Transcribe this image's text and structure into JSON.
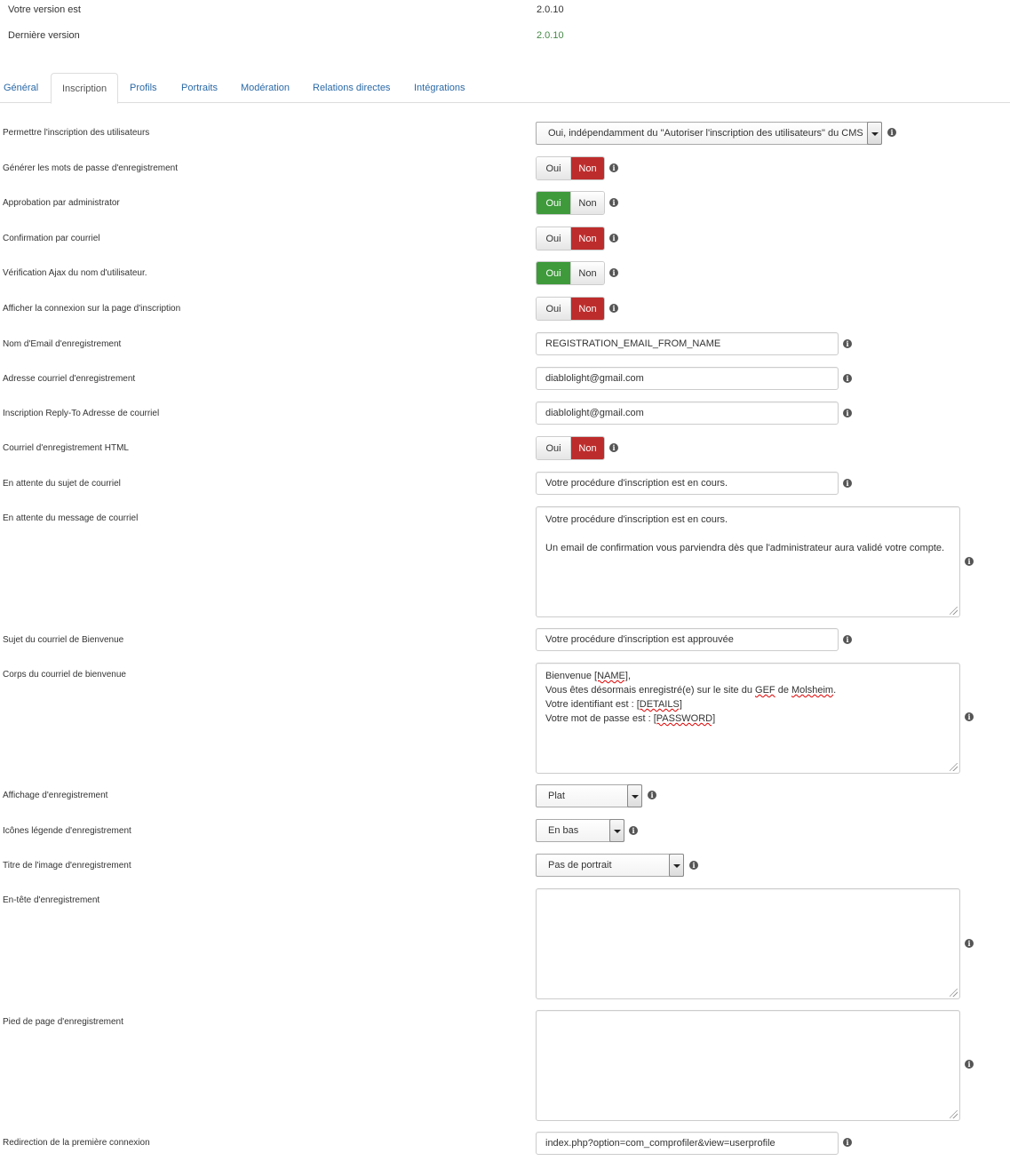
{
  "version": {
    "current_label": "Votre version est",
    "current_value": "2.0.10",
    "latest_label": "Dernière version",
    "latest_value": "2.0.10"
  },
  "tabs": [
    "Général",
    "Inscription",
    "Profils",
    "Portraits",
    "Modération",
    "Relations directes",
    "Intégrations"
  ],
  "active_tab": "Inscription",
  "colors": {
    "link": "#2a69a6",
    "yes_active": "#3e9a3b",
    "no_active": "#bd2c2c",
    "latest_version": "#468847"
  },
  "toggle_labels": {
    "yes": "Oui",
    "no": "Non"
  },
  "fields": {
    "allow_registration": {
      "label": "Permettre l'inscription des utilisateurs",
      "value": "Oui, indépendamment du \"Autoriser l'inscription des utilisateurs\" du CMS"
    },
    "generate_passwords": {
      "label": "Générer les mots de passe d'enregistrement",
      "value": "Non"
    },
    "admin_approval": {
      "label": "Approbation par administrator",
      "value": "Oui"
    },
    "email_confirmation": {
      "label": "Confirmation par courriel",
      "value": "Non"
    },
    "ajax_username_check": {
      "label": "Vérification Ajax du nom d'utilisateur.",
      "value": "Oui"
    },
    "show_login_on_registration": {
      "label": "Afficher la connexion sur la page d'inscription",
      "value": "Non"
    },
    "email_from_name": {
      "label": "Nom d'Email d'enregistrement",
      "value": "REGISTRATION_EMAIL_FROM_NAME"
    },
    "email_from_address": {
      "label": "Adresse courriel d'enregistrement",
      "value": "diablolight@gmail.com"
    },
    "reply_to_address": {
      "label": "Inscription Reply-To Adresse de courriel",
      "value": "diablolight@gmail.com"
    },
    "html_email": {
      "label": "Courriel d'enregistrement HTML",
      "value": "Non"
    },
    "pending_subject": {
      "label": "En attente du sujet de courriel",
      "value": "Votre procédure d'inscription est en cours."
    },
    "pending_message": {
      "label": "En attente du message de courriel",
      "line1": "Votre procédure d'inscription est en cours.",
      "line2": "Un email de confirmation vous parviendra dès que l'administrateur aura validé votre compte."
    },
    "welcome_subject": {
      "label": "Sujet du courriel de Bienvenue",
      "value": "Votre procédure d'inscription est approuvée"
    },
    "welcome_body": {
      "label": "Corps du courriel de bienvenue",
      "l1a": "Bienvenue ",
      "l1b": "[NAME]",
      "l1c": ",",
      "l2a": "Vous êtes désormais enregistré(e) sur le site du ",
      "l2b": "GEF",
      "l2c": " de ",
      "l2d": "Molsheim",
      "l2e": ".",
      "l3a": "Votre identifiant est : ",
      "l3b": "[DETAILS]",
      "l4a": "Votre mot de passe est : ",
      "l4b": "[PASSWORD]"
    },
    "registration_display": {
      "label": "Affichage d'enregistrement",
      "value": "Plat"
    },
    "legend_icons": {
      "label": "Icônes légende d'enregistrement",
      "value": "En bas"
    },
    "image_title": {
      "label": "Titre de l'image d'enregistrement",
      "value": "Pas de portrait"
    },
    "header": {
      "label": "En-tête d'enregistrement",
      "value": ""
    },
    "footer": {
      "label": "Pied de page d'enregistrement",
      "value": ""
    },
    "first_login_redirect": {
      "label": "Redirection de la première connexion",
      "value": "index.php?option=com_comprofiler&view=userprofile"
    }
  }
}
